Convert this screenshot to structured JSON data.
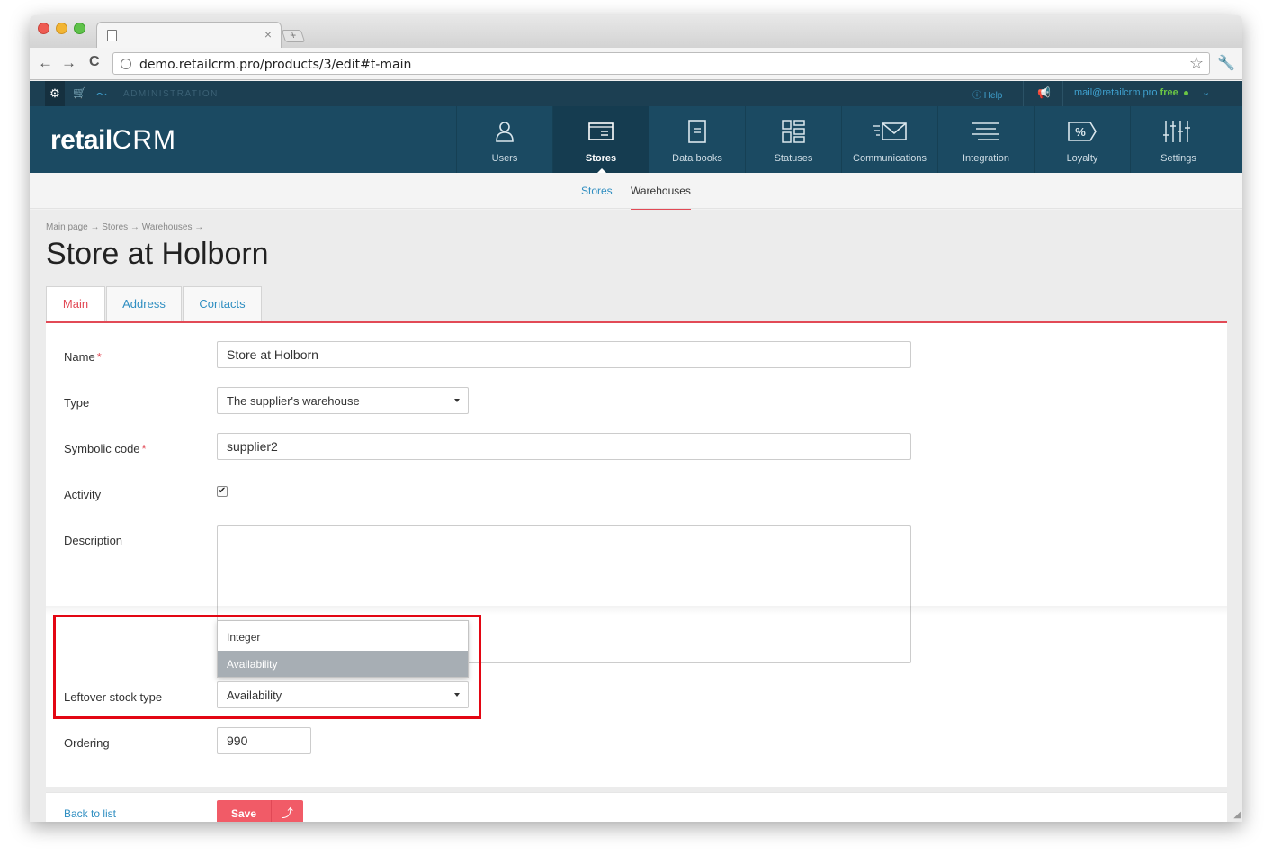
{
  "browser": {
    "url": "demo.retailcrm.pro/products/3/edit#t-main",
    "tab_close": "×",
    "new_tab": "+",
    "back": "←",
    "forward": "→",
    "reload": "C",
    "star": "☆",
    "wrench": "🔧"
  },
  "adminbar": {
    "label": "ADMINISTRATION",
    "help": "Help",
    "account_email": "mail@retailcrm.pro",
    "account_plan": "free",
    "gear": "⚙",
    "cart": "🛒",
    "chart": "〜",
    "chevron": "⌄",
    "megaphone": "📢"
  },
  "header": {
    "logo_retail": "retail",
    "logo_crm": "CRM",
    "nav": [
      {
        "label": "Users",
        "icon": "user-icon"
      },
      {
        "label": "Stores",
        "icon": "store-window-icon",
        "active": true
      },
      {
        "label": "Data books",
        "icon": "book-icon"
      },
      {
        "label": "Statuses",
        "icon": "statuses-icon"
      },
      {
        "label": "Communications",
        "icon": "envelope-icon"
      },
      {
        "label": "Integration",
        "icon": "integration-icon"
      },
      {
        "label": "Loyalty",
        "icon": "percent-tag-icon"
      },
      {
        "label": "Settings",
        "icon": "sliders-icon"
      }
    ]
  },
  "subnav": {
    "stores": "Stores",
    "warehouses": "Warehouses"
  },
  "breadcrumb": "Main page → Stores → Warehouses →",
  "page_title": "Store at Holborn",
  "tabs": [
    "Main",
    "Address",
    "Contacts"
  ],
  "form": {
    "name_label": "Name",
    "name_value": "Store at Holborn",
    "type_label": "Type",
    "type_value": "The supplier's warehouse",
    "code_label": "Symbolic code",
    "code_value": "supplier2",
    "activity_label": "Activity",
    "activity_checked": true,
    "description_label": "Description",
    "description_value": "",
    "stock_label": "Leftover stock type",
    "stock_value": "Availability",
    "stock_options": [
      "Integer",
      "Availability"
    ],
    "ordering_label": "Ordering",
    "ordering_value": "990",
    "required_mark": "*",
    "check_mark": "✔"
  },
  "footer": {
    "back": "Back to list",
    "save": "Save",
    "save_arrow": "⤴"
  },
  "colors": {
    "accent": "#e24a56",
    "header": "#1b4a62",
    "link": "#2f8ec1"
  }
}
